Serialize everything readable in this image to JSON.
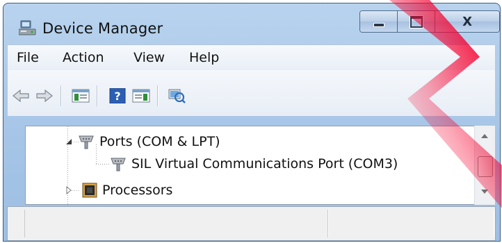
{
  "window": {
    "title": "Device Manager",
    "icon": "device-manager-icon"
  },
  "caption_buttons": {
    "minimize_icon": "minimize-icon",
    "maximize_icon": "maximize-icon",
    "close_label": "X"
  },
  "menu": {
    "items": [
      {
        "label": "File"
      },
      {
        "label": "Action"
      },
      {
        "label": "View"
      },
      {
        "label": "Help"
      }
    ]
  },
  "toolbar": {
    "buttons": [
      "back-arrow-icon",
      "forward-arrow-icon",
      "show-hide-console-tree-icon",
      "help-icon",
      "action-pane-icon",
      "scan-hardware-changes-icon"
    ]
  },
  "tree": {
    "rows": [
      {
        "label": "Ports (COM & LPT)",
        "icon": "port-icon",
        "expander": "expanded"
      },
      {
        "label": "SIL Virtual Communications Port (COM3)",
        "icon": "port-icon"
      },
      {
        "label": "Processors",
        "icon": "processor-icon",
        "expander": "collapsed"
      }
    ]
  },
  "colors": {
    "accent_overlay": "#f5002e",
    "frame": "#a5c4e6"
  }
}
